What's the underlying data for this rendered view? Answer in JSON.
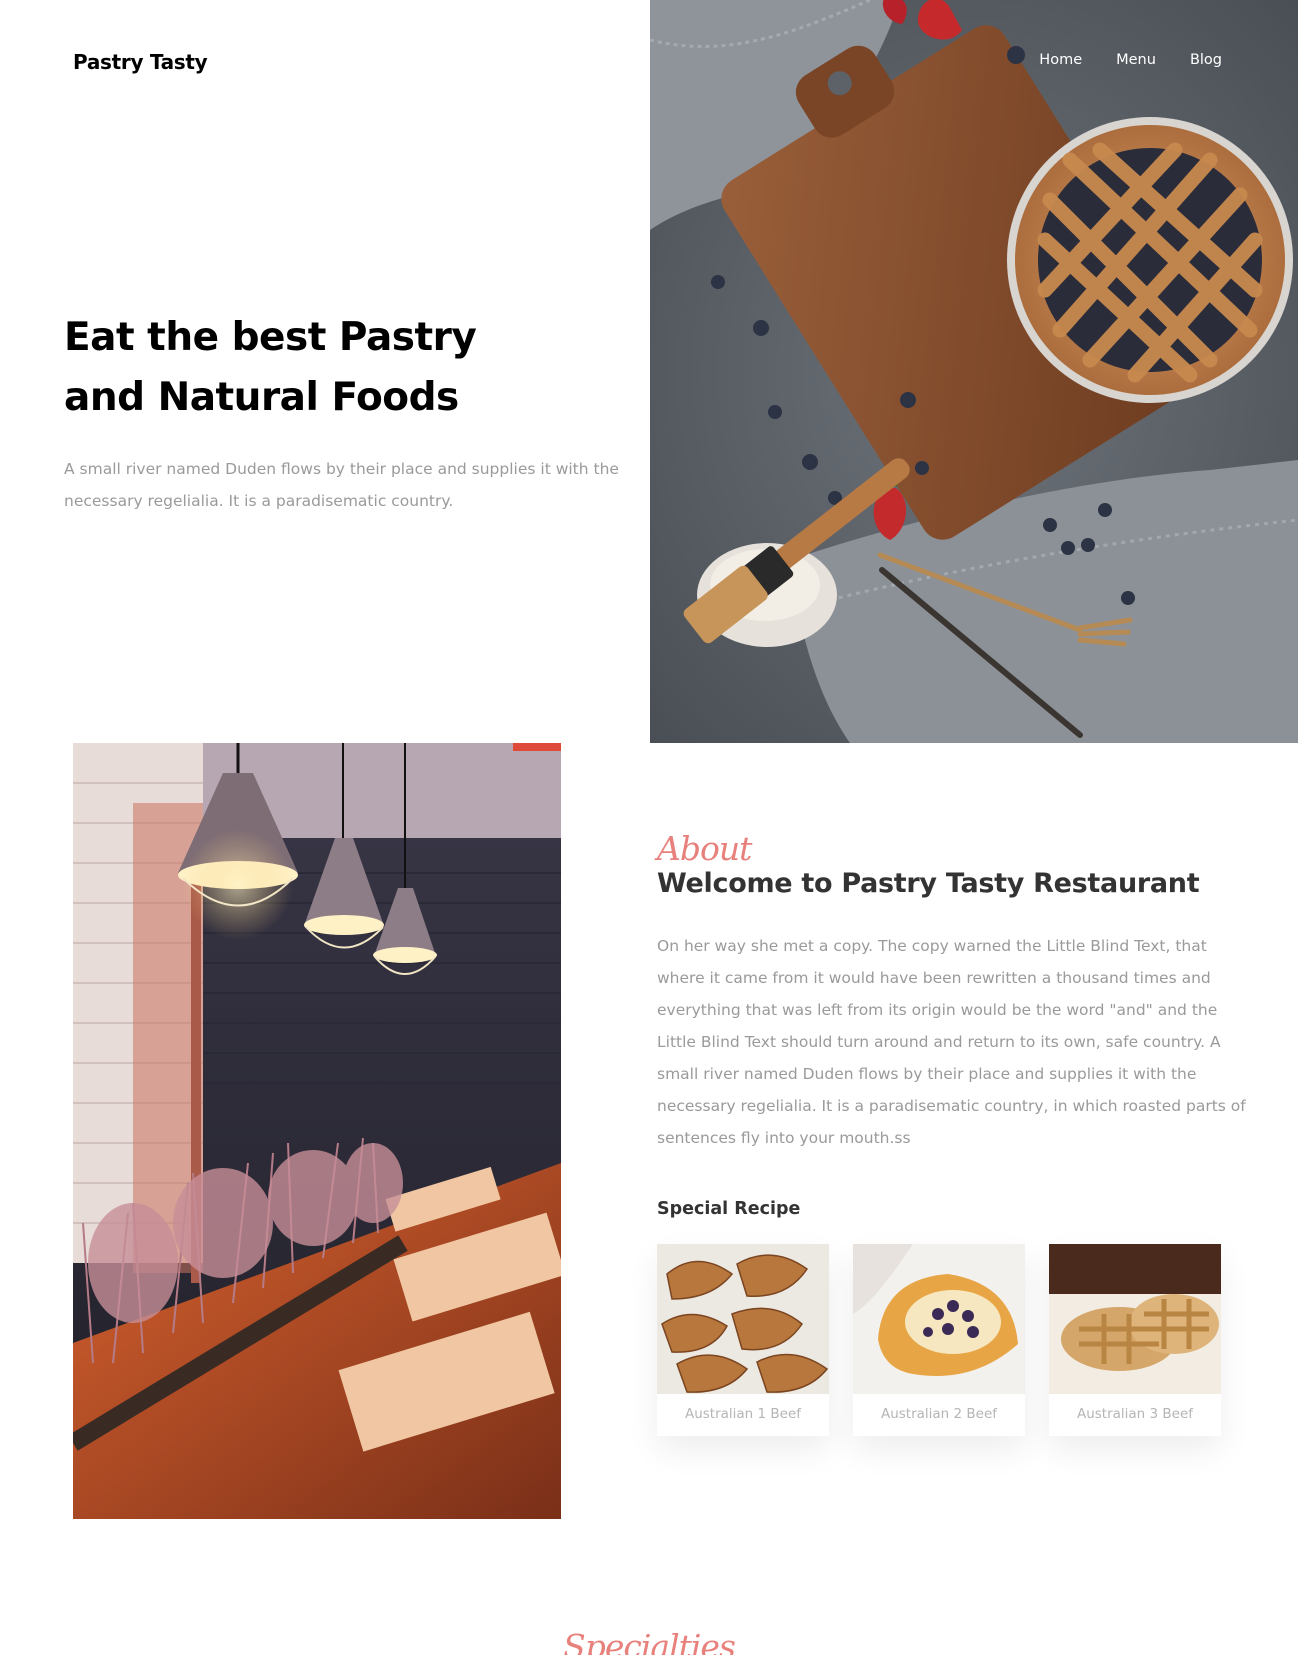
{
  "brand": {
    "name": "Pastry Tasty"
  },
  "nav": {
    "items": [
      "Home",
      "Menu",
      "Blog"
    ]
  },
  "hero": {
    "title_line1": "Eat the best Pastry",
    "title_line2": "and Natural Foods",
    "description": "A small river named Duden flows by their place and supplies it with the necessary regelialia. It is a paradisematic country."
  },
  "about": {
    "subheading": "About",
    "title": "Welcome to Pastry Tasty Restaurant",
    "body": "On her way she met a copy. The copy warned the Little Blind Text, that where it came from it would have been rewritten a thousand times and everything that was left from its origin would be the word \"and\" and the Little Blind Text should turn around and return to its own, safe country. A small river named Duden flows by their place and supplies it with the necessary regelialia. It is a paradisematic country, in which roasted parts of sentences fly into your mouth.ss",
    "special_label": "Special Recipe",
    "recipes": [
      {
        "name": "Australian 1 Beef"
      },
      {
        "name": "Australian 2 Beef"
      },
      {
        "name": "Australian 3 Beef"
      }
    ]
  },
  "specialties": {
    "subheading": "Specialties"
  },
  "colors": {
    "accent_script": "#e8807c",
    "heading": "#333333",
    "muted_text": "#9a9a9a"
  }
}
